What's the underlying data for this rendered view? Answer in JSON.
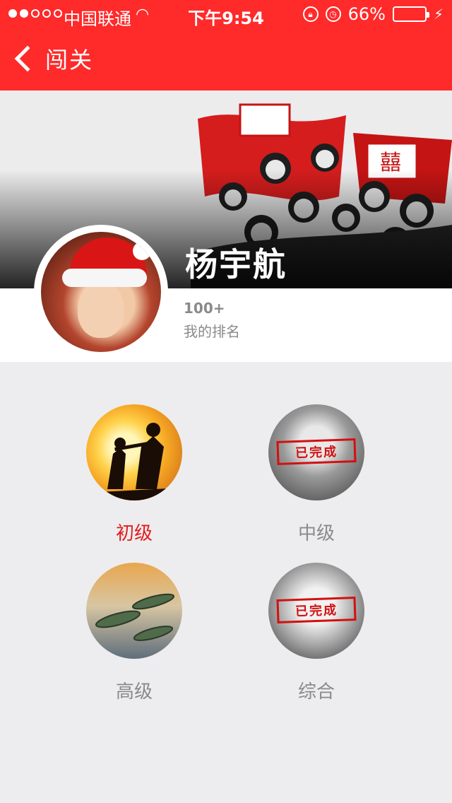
{
  "status_bar": {
    "carrier": "中国联通",
    "time": "下午9:54",
    "battery_percent": "66%",
    "battery_level": 0.66,
    "signal_bars": 2
  },
  "nav": {
    "back_icon": "chevron-left-icon",
    "title": "闯关"
  },
  "profile": {
    "name": "杨宇航",
    "rank_value": "100+",
    "rank_label": "我的排名"
  },
  "levels": [
    {
      "label": "初级",
      "active": true,
      "completed": false
    },
    {
      "label": "中级",
      "active": false,
      "completed": true,
      "stamp": "已完成"
    },
    {
      "label": "高级",
      "active": false,
      "completed": false
    },
    {
      "label": "综合",
      "active": false,
      "completed": true,
      "stamp": "已完成"
    }
  ],
  "colors": {
    "brand_red": "#ff2a2a",
    "active_label": "#e41b1b",
    "inactive_label": "#8a8a8a",
    "battery_green": "#4cd964"
  }
}
